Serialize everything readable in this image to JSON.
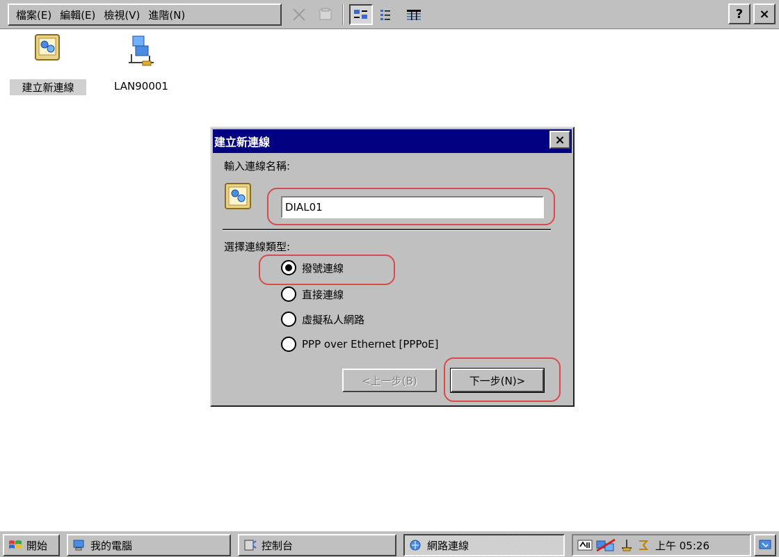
{
  "menubar": {
    "items": [
      "檔案(E)",
      "編輯(E)",
      "檢視(V)",
      "進階(N)"
    ]
  },
  "toolbar": {
    "help_label": "?",
    "close_label": "×"
  },
  "desktop": {
    "icons": [
      {
        "label": "建立新連線",
        "icon": "make-new-connection-icon",
        "selected": true
      },
      {
        "label": "LAN90001",
        "icon": "lan-connection-icon",
        "selected": false
      }
    ]
  },
  "dialog": {
    "title": "建立新連線",
    "close_label": "×",
    "name_prompt": "輸入連線名稱:",
    "name_value": "DIAL01",
    "type_prompt": "選擇連線類型:",
    "options": [
      {
        "label": "撥號連線",
        "checked": true
      },
      {
        "label": "直接連線",
        "checked": false
      },
      {
        "label": "虛擬私人網路",
        "checked": false
      },
      {
        "label": "PPP over Ethernet [PPPoE]",
        "checked": false
      }
    ],
    "back_button": "<上一步(B)",
    "next_button": "下一步(N)>",
    "annotation_color": "#d94a4a"
  },
  "taskbar": {
    "start_label": "開始",
    "buttons": [
      "我的電腦",
      "控制台",
      "網路連線"
    ],
    "active_button": "網路連線",
    "clock": "上午 05:26"
  }
}
